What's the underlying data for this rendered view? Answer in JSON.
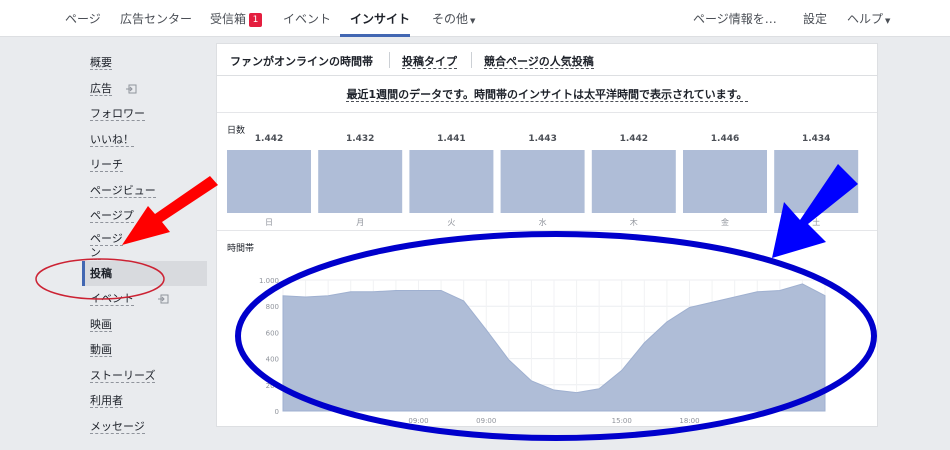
{
  "nav": {
    "items": [
      "ページ",
      "広告センター",
      "受信箱",
      "イベント",
      "インサイト",
      "その他"
    ],
    "inbox_badge": "1",
    "right": [
      "ページ情報を…",
      "設定",
      "ヘルプ"
    ]
  },
  "sidebar": {
    "items": [
      "概要",
      "広告",
      "フォロワー",
      "いいね！",
      "リーチ",
      "ページビュー",
      "ページプ",
      "ページ",
      "ン",
      "投稿",
      "イベント",
      "映画",
      "動画",
      "ストーリーズ",
      "利用者",
      "メッセージ"
    ],
    "active_index": 9
  },
  "tabs": [
    "ファンがオンラインの時間帯",
    "投稿タイプ",
    "競合ページの人気投稿"
  ],
  "subtitle": "最近1週間のデータです。時間帯のインサイトは太平洋時間で表示されています。",
  "days_label": "日数",
  "hours_label": "時間帯",
  "colors": {
    "bar": "#afbdd7",
    "area": "#afbdd7",
    "accent": "#4267b2",
    "red_arrow": "#ff0000",
    "blue_arrow": "#0000ff"
  },
  "chart_data": [
    {
      "type": "bar",
      "title": "日数",
      "categories": [
        "日",
        "月",
        "火",
        "水",
        "木",
        "金",
        "土"
      ],
      "values": [
        "1.442",
        "1.432",
        "1.441",
        "1.443",
        "1.442",
        "1.446",
        "1.434"
      ]
    },
    {
      "type": "area",
      "title": "時間帯",
      "y_ticks": [
        "0",
        "200",
        "400",
        "600",
        "800",
        "1.000"
      ],
      "ylim": [
        0,
        1000
      ],
      "x_ticks": [
        "09:00",
        "09:00",
        "15:00",
        "18:00"
      ],
      "x": [
        0,
        1,
        2,
        3,
        4,
        5,
        6,
        7,
        8,
        9,
        10,
        11,
        12,
        13,
        14,
        15,
        16,
        17,
        18,
        19,
        20,
        21,
        22,
        23,
        24
      ],
      "y": [
        880,
        870,
        880,
        910,
        910,
        920,
        920,
        920,
        840,
        620,
        390,
        230,
        160,
        140,
        170,
        310,
        520,
        680,
        790,
        830,
        870,
        910,
        920,
        970,
        880
      ]
    }
  ]
}
